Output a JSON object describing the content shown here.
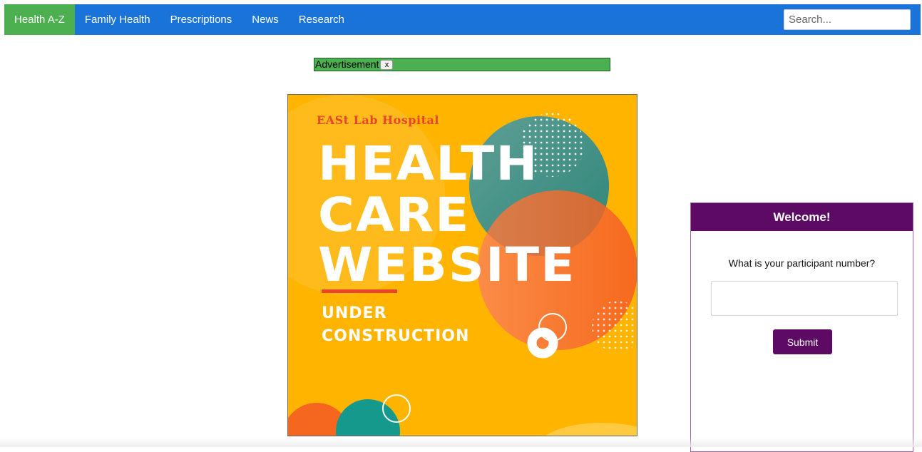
{
  "nav": {
    "items": [
      {
        "label": "Health A-Z",
        "active": true
      },
      {
        "label": "Family Health",
        "active": false
      },
      {
        "label": "Prescriptions",
        "active": false
      },
      {
        "label": "News",
        "active": false
      },
      {
        "label": "Research",
        "active": false
      }
    ],
    "search_placeholder": "Search..."
  },
  "ad": {
    "label": "Advertisement",
    "close_label": "x"
  },
  "poster": {
    "hospital_name": "EASt Lab Hospital",
    "headline": [
      "HEALTH",
      "CARE",
      "WEBSITE"
    ],
    "subline": [
      "UNDER",
      "CONSTRUCTION"
    ]
  },
  "welcome": {
    "title": "Welcome!",
    "question": "What is your participant number?",
    "input_value": "",
    "submit_label": "Submit"
  },
  "colors": {
    "nav_bg": "#1a73d9",
    "nav_active": "#4caf50",
    "ad_bg": "#4caf50",
    "poster_bg": "#ffb400",
    "welcome_accent": "#5c0a63"
  }
}
